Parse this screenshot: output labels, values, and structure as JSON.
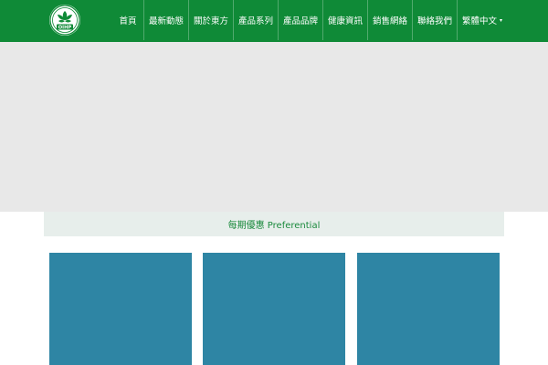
{
  "header": {
    "logo_text": "OIHP",
    "nav": [
      {
        "label": "首頁"
      },
      {
        "label": "最新動態"
      },
      {
        "label": "關於東方"
      },
      {
        "label": "產品系列"
      },
      {
        "label": "產品品牌"
      },
      {
        "label": "健康資訊"
      },
      {
        "label": "銷售網絡"
      },
      {
        "label": "聯絡我們"
      },
      {
        "label": "繁體中文"
      }
    ],
    "language_caret": "▾"
  },
  "section": {
    "title": "每期優惠 Preferential"
  },
  "colors": {
    "header_bg": "#0f8a37",
    "hero_bg": "#e8e8e8",
    "section_bg": "#e7eeeb",
    "section_text": "#1b8a3d",
    "card_bg": "#2e85a4"
  }
}
